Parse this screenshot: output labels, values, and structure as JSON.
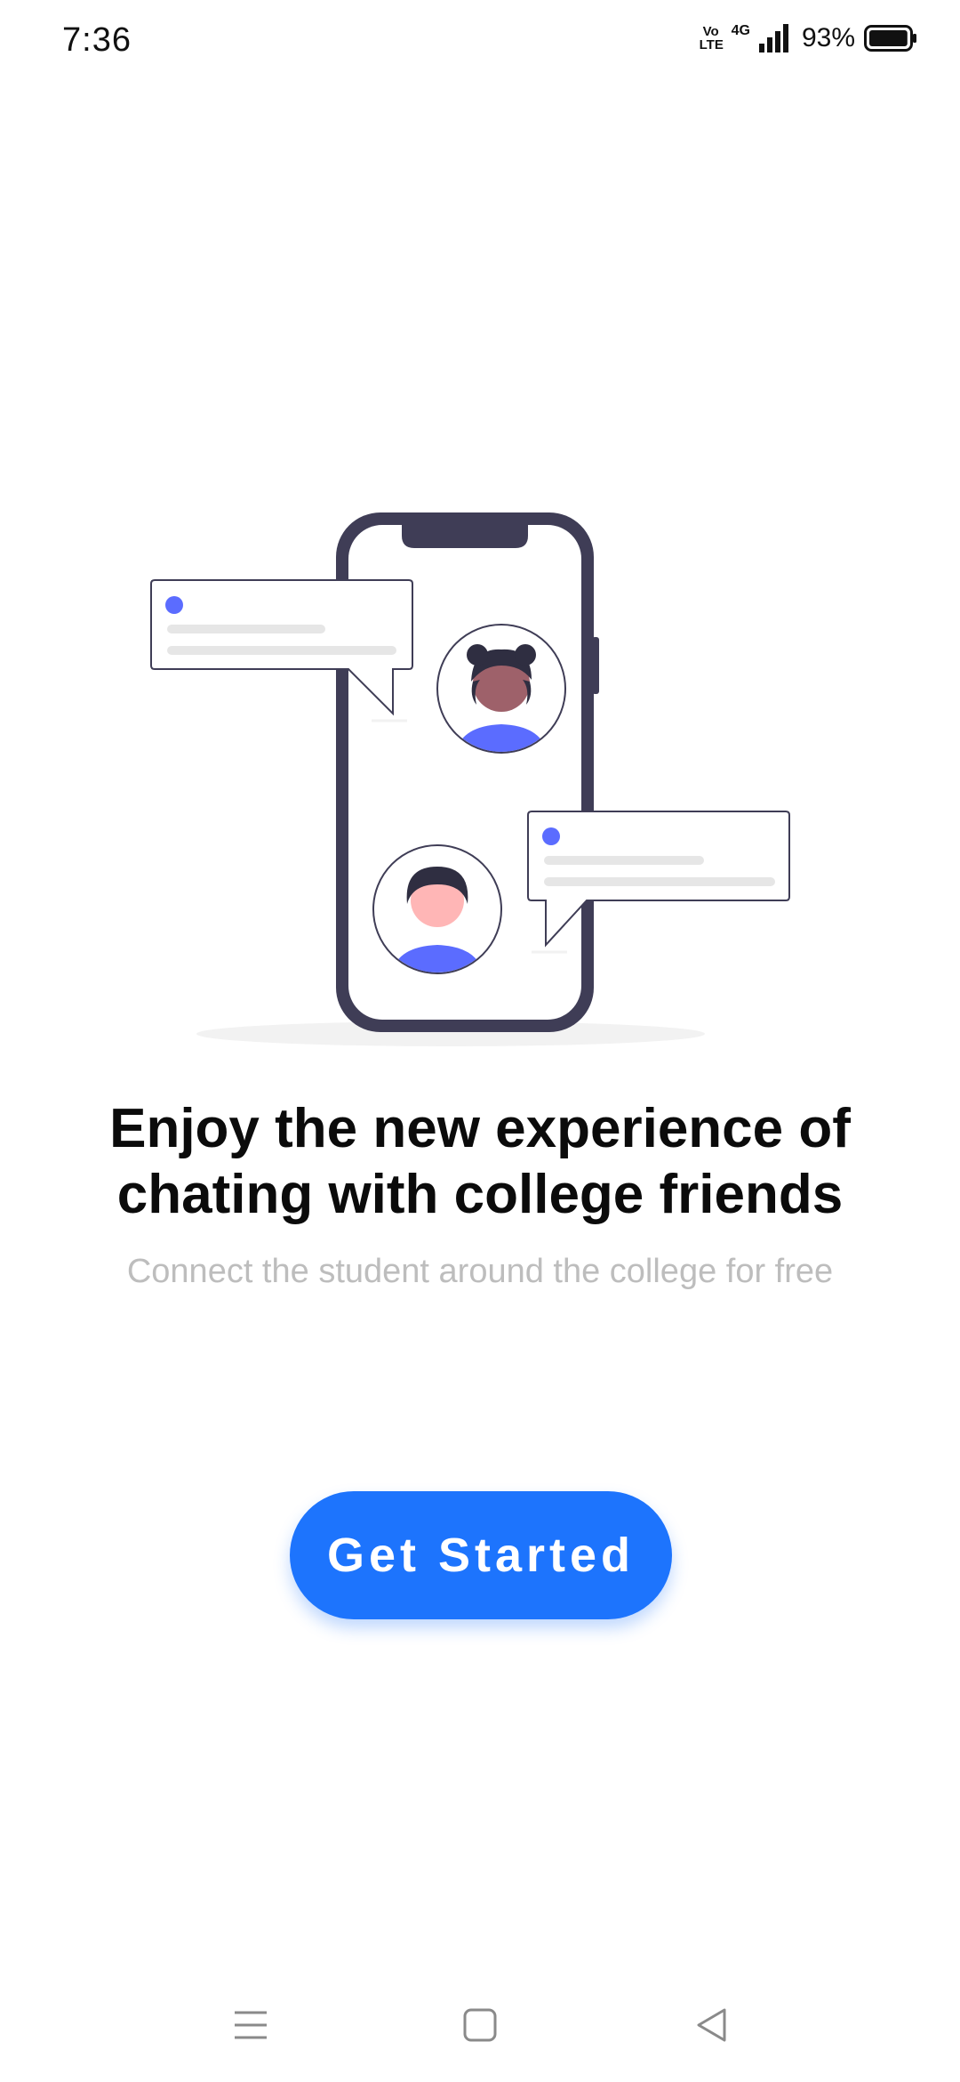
{
  "status_bar": {
    "time": "7:36",
    "volte_top": "Vo",
    "volte_bottom": "LTE",
    "network": "4G",
    "battery_percent": "93%",
    "battery_level": 0.93,
    "icons": [
      "volte-icon",
      "signal-icon",
      "battery-icon"
    ]
  },
  "illustration": {
    "description_icon": "phone-chat-illustration",
    "colors": {
      "phone_frame": "#3f3d56",
      "accent": "#6c63ff",
      "person_shirt": "#5b6cff",
      "skin_dark": "#9e616a",
      "skin_light": "#ffb6b6",
      "hair": "#2f2e41",
      "line_gray": "#e6e6e6",
      "shadow": "#f2f2f2"
    }
  },
  "onboarding": {
    "headline_line1": "Enjoy the new experience of",
    "headline_line2": "chating with college friends",
    "subtitle": "Connect the student around the college for free",
    "cta_label": "Get Started"
  },
  "theme": {
    "primary": "#1d74fd",
    "text": "#0b0b0b",
    "muted": "#bdbdbd"
  },
  "nav_bar": {
    "icons": [
      "menu-icon",
      "home-icon",
      "back-icon"
    ]
  }
}
